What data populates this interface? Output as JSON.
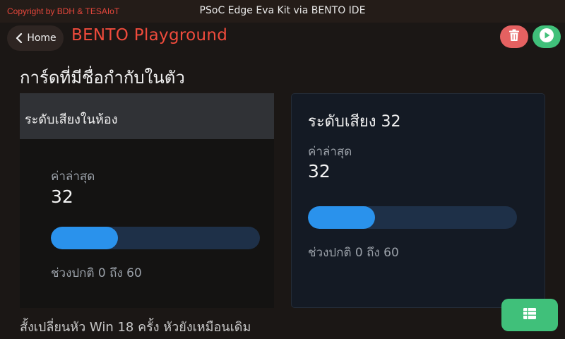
{
  "header": {
    "copyright": "Copyright by BDH & TESAIoT",
    "window_title": "PSoC Edge Eva Kit via BENTO IDE",
    "home_label": "Home",
    "app_title": "BENTO Playground"
  },
  "colors": {
    "accent_red": "#ef4b3c",
    "delete_button": "#e56161",
    "run_button": "#40c07a",
    "progress_fill": "#2a92ec",
    "progress_track": "#1e3048"
  },
  "icons": {
    "home": "chevron-left-icon",
    "delete": "trash-icon",
    "run": "play-icon",
    "fab": "table-icon"
  },
  "main": {
    "section_title": "การ์ดที่มีชื่อกำกับในตัว",
    "cards": [
      {
        "header": "ระดับเสียงในห้อง",
        "latest_label": "ค่าล่าสุด",
        "latest_value": "32",
        "progress_fraction": 0.32,
        "range_text": "ช่วงปกติ 0 ถึง 60"
      },
      {
        "title": "ระดับเสียง 32",
        "latest_label": "ค่าล่าสุด",
        "latest_value": "32",
        "progress_fraction": 0.32,
        "range_text": "ช่วงปกติ 0 ถึง 60"
      }
    ],
    "footer_text": "สั้งเปลี่ยนหัว Win 18 ครั้ง หัวยังเหมือนเดิม"
  }
}
